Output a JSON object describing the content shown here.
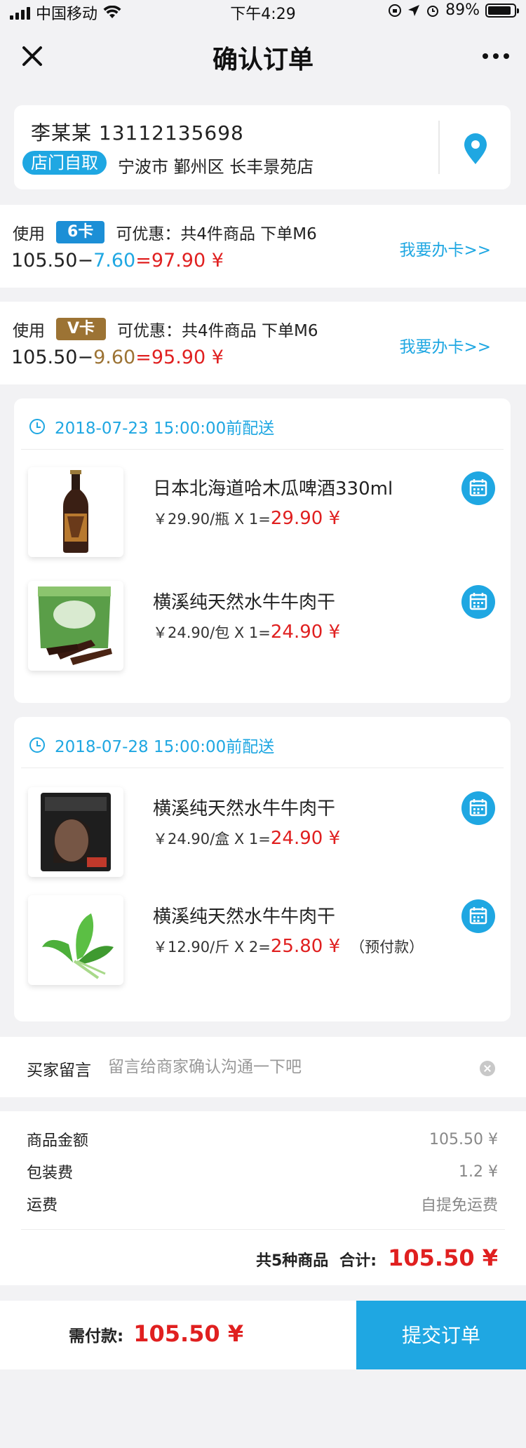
{
  "status_bar": {
    "carrier": "中国移动",
    "time": "下午4:29",
    "battery_text": "89%",
    "battery_level": 0.89
  },
  "nav": {
    "title": "确认订单",
    "close_icon": "close-icon",
    "more_icon": "more-dots-icon"
  },
  "address": {
    "name_phone": "李某某  13112135698",
    "pickup_tag": "店门自取",
    "store": "宁波市 鄞州区 长丰景苑店",
    "icon": "location-pin-icon"
  },
  "member_cards": [
    {
      "use": "使用",
      "card": "6卡",
      "badge_color": "#1c8fd6",
      "desc": "可优惠：共4件商品 下单M6",
      "base": "105.50",
      "minus": "−",
      "discount": "7.60",
      "discount_color": "#1fa7e2",
      "result": "=97.90 ¥",
      "link": "我要办卡>>"
    },
    {
      "use": "使用",
      "card": "V卡",
      "badge_color": "#9c7334",
      "desc": "可优惠：共4件商品 下单M6",
      "base": "105.50",
      "minus": "−",
      "discount": "9.60",
      "discount_color": "#9c7334",
      "result": "=95.90 ¥",
      "link": "我要办卡>>"
    }
  ],
  "groups": [
    {
      "delivery": "2018-07-23   15:00:00前配送",
      "items": [
        {
          "name": "日本北海道哈木瓜啤酒330ml",
          "price": "￥29.90/瓶 X 1=",
          "total": "29.90 ¥",
          "note": "",
          "thumb": "beer-bottle-image"
        },
        {
          "name": "横溪纯天然水牛牛肉干",
          "price": "￥24.90/包 X 1=",
          "total": "24.90 ¥",
          "note": "",
          "thumb": "beef-jerky-bag-image"
        }
      ]
    },
    {
      "delivery": "2018-07-28   15:00:00前配送",
      "items": [
        {
          "name": "横溪纯天然水牛牛肉干",
          "price": "￥24.90/盒 X 1=",
          "total": "24.90 ¥",
          "note": "",
          "thumb": "jerky-box-image"
        },
        {
          "name": "横溪纯天然水牛牛肉干",
          "price": "￥12.90/斤 X 2=",
          "total": "25.80 ¥",
          "note": "（预付款）",
          "thumb": "spinach-image"
        }
      ]
    }
  ],
  "message": {
    "label": "买家留言",
    "placeholder": "留言给商家确认沟通一下吧",
    "value": ""
  },
  "summary": {
    "rows": [
      {
        "k": "商品金额",
        "v": "105.50 ¥"
      },
      {
        "k": "包装费",
        "v": "1.2 ¥"
      },
      {
        "k": "运费",
        "v": "自提免运费"
      }
    ],
    "count": "共5种商品",
    "total_label": "合计:",
    "total": "105.50 ¥"
  },
  "bottom": {
    "pay_label": "需付款:",
    "pay_amount": "105.50 ¥",
    "submit": "提交订单"
  },
  "colors": {
    "accent": "#1fa7e2",
    "price_red": "#e02020"
  }
}
